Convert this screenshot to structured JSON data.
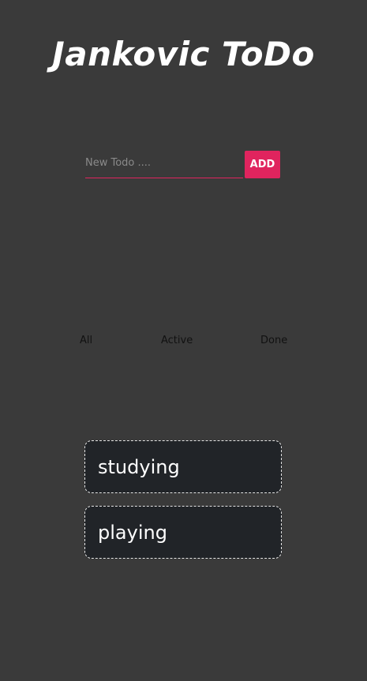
{
  "app": {
    "title": "Jankovic ToDo"
  },
  "form": {
    "input_value": "",
    "input_placeholder": "New Todo ....",
    "add_label": "ADD"
  },
  "filters": [
    {
      "label": "All"
    },
    {
      "label": "Active"
    },
    {
      "label": "Done"
    }
  ],
  "todos": [
    {
      "text": "studying"
    },
    {
      "text": "playing"
    }
  ],
  "colors": {
    "background": "#3a3a3a",
    "accent": "#e0245e",
    "card": "#212428",
    "title": "#ffffff"
  }
}
